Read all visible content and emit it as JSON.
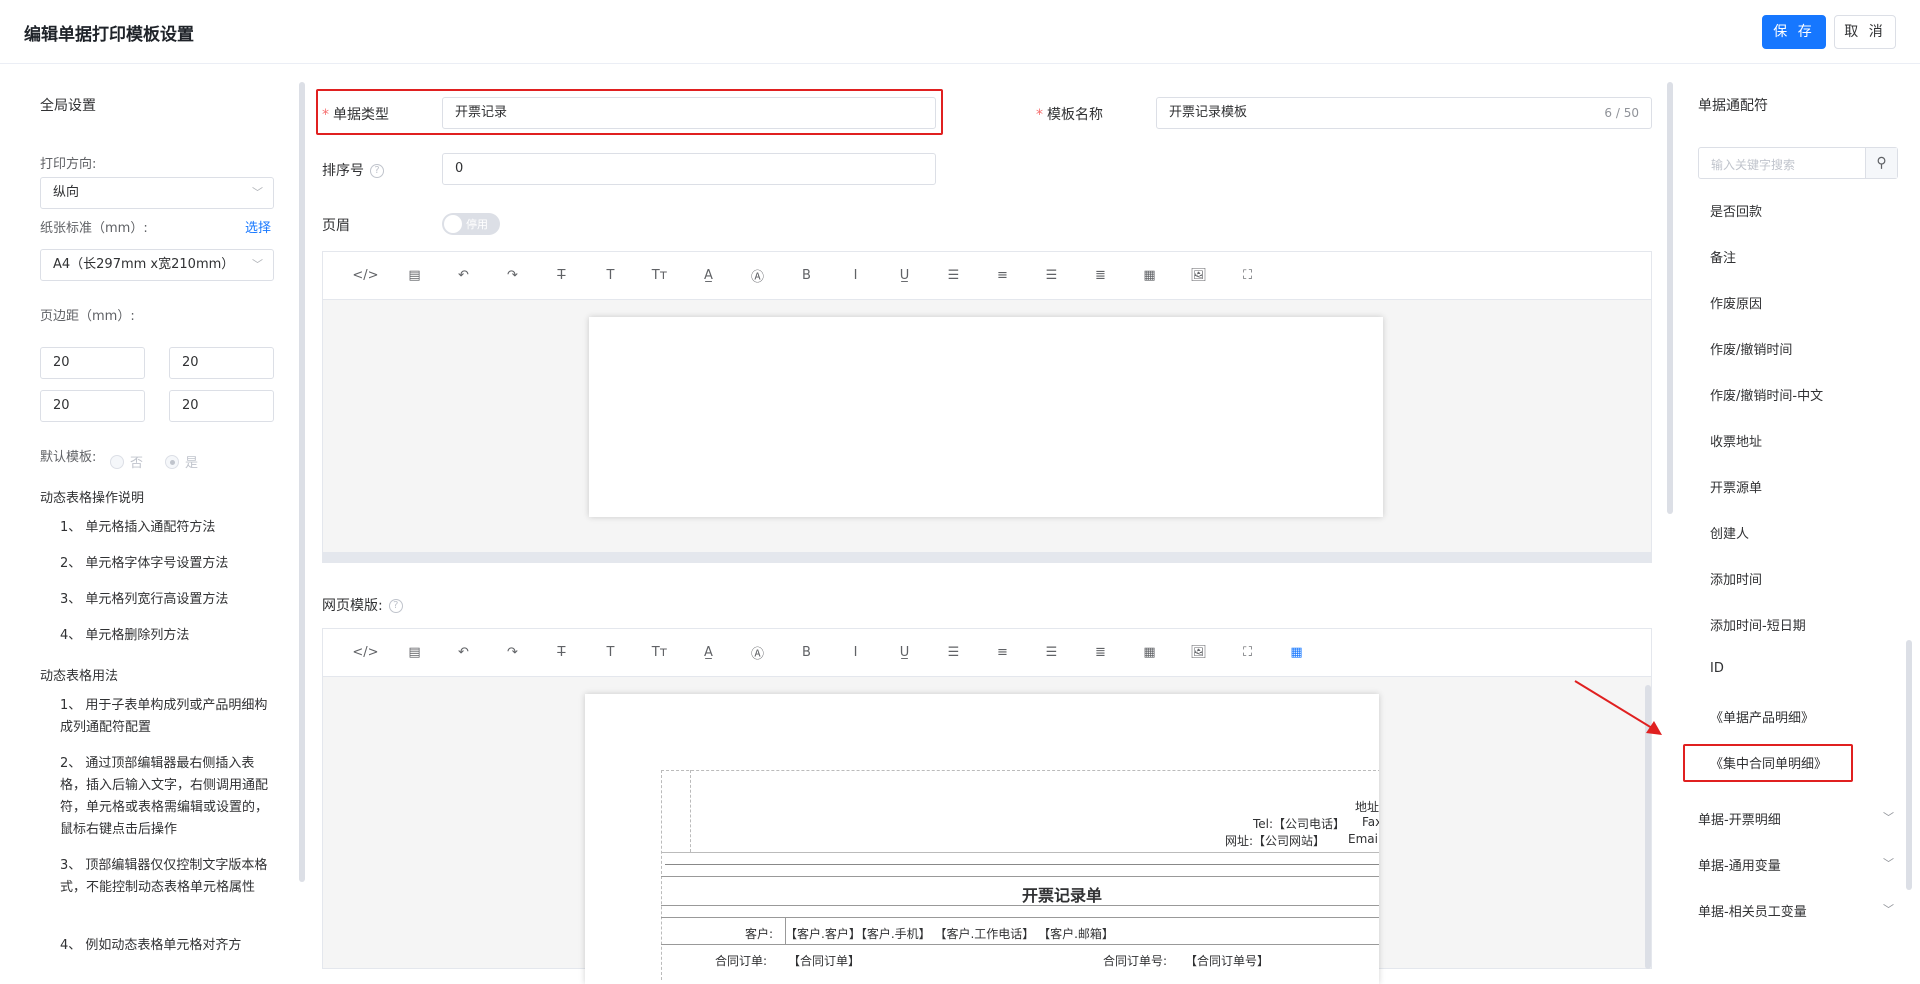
{
  "header": {
    "title": "编辑单据打印模板设置",
    "save_label": "保 存",
    "cancel_label": "取 消"
  },
  "global_settings": {
    "title": "全局设置",
    "orientation_label": "打印方向:",
    "orientation_value": "纵向",
    "paper_label": "纸张标准（mm）:",
    "paper_select_link": "选择",
    "paper_value": "A4（长297mm x宽210mm）",
    "margin_label": "页边距（mm）:",
    "margins": [
      "20",
      "20",
      "20",
      "20"
    ],
    "default_template_label": "默认模板:",
    "default_no": "否",
    "default_yes": "是",
    "default_selected": "是",
    "help_ops_title": "动态表格操作说明",
    "help_ops": [
      "1、 单元格插入通配符方法",
      "2、 单元格字体字号设置方法",
      "3、 单元格列宽行高设置方法",
      "4、 单元格删除列方法"
    ],
    "help_usage_title": "动态表格用法",
    "help_usage": [
      "1、 用于子表单构成列或产品明细构成列通配符配置",
      "2、 通过顶部编辑器最右侧插入表格，插入后输入文字，右侧调用通配符，单元格或表格需编辑或设置的，鼠标右键点击后操作",
      "3、 顶部编辑器仅仅控制文字版本格式，不能控制动态表格单元格属性",
      "4、 例如动态表格单元格对齐方"
    ]
  },
  "form": {
    "doc_type_label": "单据类型",
    "doc_type_value": "开票记录",
    "template_name_label": "模板名称",
    "template_name_value": "开票记录模板",
    "template_name_count": "6 / 50",
    "sort_label": "排序号",
    "sort_value": "0",
    "header_label": "页眉",
    "header_switch_text": "停用",
    "web_template_label": "网页模版:"
  },
  "toolbar_icons": [
    "code-icon",
    "template-icon",
    "undo-icon",
    "redo-icon",
    "strikethrough-icon",
    "font-icon",
    "font-size-icon",
    "font-color-icon",
    "bg-color-icon",
    "bold-icon",
    "italic-icon",
    "underline-icon",
    "align-left-icon",
    "align-center-icon",
    "align-right-icon",
    "justify-icon",
    "table-icon",
    "image-icon",
    "fullscreen-icon"
  ],
  "toolbar_glyphs": [
    "</>",
    "▤",
    "↶",
    "↷",
    "T̶",
    "T",
    "Tт",
    "A̲",
    "Ⓐ",
    "B",
    "I",
    "U̲",
    "☰",
    "≡",
    "☰",
    "≣",
    "▦",
    "🖼",
    "⛶"
  ],
  "doc_preview": {
    "address": "地址",
    "tel": "Tel:【公司电话】",
    "fax": "Fax",
    "website": "网址:【公司网站】",
    "email": "Email:",
    "title": "开票记录单",
    "customer_label": "客户:",
    "customer_value": "【客户.客户】【客户.手机】 【客户.工作电话】 【客户.邮箱】",
    "contract_label": "合同订单:",
    "contract_value": "【合同订单】",
    "contract_no_label": "合同订单号:",
    "contract_no_value": "【合同订单号】"
  },
  "wildcards": {
    "title": "单据通配符",
    "search_placeholder": "输入关键字搜索",
    "items": [
      "是否回款",
      "备注",
      "作废原因",
      "作废/撤销时间",
      "作废/撤销时间-中文",
      "收票地址",
      "开票源单",
      "创建人",
      "添加时间",
      "添加时间-短日期",
      "ID",
      "《单据产品明细》",
      "《集中合同单明细》"
    ],
    "groups": [
      "单据-开票明细",
      "单据-通用变量",
      "单据-相关员工变量"
    ]
  }
}
